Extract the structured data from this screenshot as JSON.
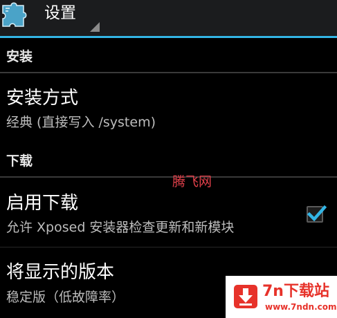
{
  "action_bar": {
    "title": "设置",
    "icon": "puzzle-piece-icon",
    "accent_color": "#33b5e5"
  },
  "sections": {
    "install": {
      "header": "安装",
      "method": {
        "title": "安装方式",
        "summary": "经典 (直接写入 /system)"
      }
    },
    "download": {
      "header": "下载",
      "enable": {
        "title": "启用下载",
        "summary": "允许 Xposed 安装器检查更新和新模块",
        "checked": true
      },
      "version": {
        "title": "将显示的版本",
        "summary": "稳定版（低故障率）"
      }
    }
  },
  "watermarks": {
    "site_text": "腾飞网",
    "brand_name": "7n下载站",
    "brand_url": "www.7ndn.com",
    "brand_color": "#e7322a"
  }
}
